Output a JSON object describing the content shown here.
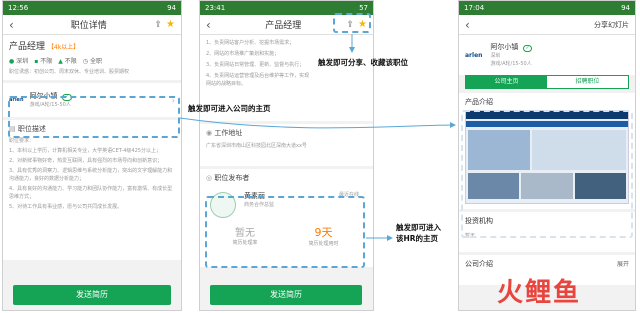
{
  "phone1": {
    "status": {
      "time": "12:56",
      "battery": "94"
    },
    "nav_title": "职位详情",
    "job_title": "产品经理",
    "salary": "【4k以上】",
    "tags": [
      "深圳",
      "不限",
      "不限",
      "全职"
    ],
    "benefits": "职位诱惑：初创公司、周末双休、专业培训、股票期权",
    "company_name": "阿尔小镇",
    "company_sub": "游戏/A轮/15-50人",
    "desc_header": "职位描述",
    "desc_lines": [
      "职位要求：",
      "1、本科以上学历，计算机相关专业，大学英语CET-4级425分以上；",
      "2、对新鲜事物好奇，热爱互联网，具有强烈的市场导向和创新意识；",
      "3、具有优秀的洞察力、逻辑思维与系统分析能力，突出的文字理解能力和沟通能力，良好的数据分析能力；",
      "4、具有良好的沟通能力、学习能力和团队协作能力，富有激情、有成长型思维方式；",
      "5、对待工作具有事业感，愿与公司共同成长发展。"
    ],
    "send_button": "发送简历"
  },
  "phone2": {
    "status": {
      "time": "23:41",
      "battery": "57"
    },
    "nav_title": "产品经理",
    "duties": [
      "1、负责网站客户分析、挖掘市场需求；",
      "2、网站的市场推广策划和实施；",
      "3、负责网站日常管理、更新、监督与执行；",
      "4、负责网站运营管理及后台维护等工作，实现网站的战略目标。"
    ],
    "address_header": "工作地址",
    "address": "广东省深圳市南山区科技园北区深南大道xx号",
    "publisher_header": "职位发布者",
    "publisher_name": "黄素丽",
    "publisher_role": "商务合作总监",
    "publisher_online": "最近在线",
    "stat1_value": "暂无",
    "stat1_label": "简历处理率",
    "stat2_value": "9天",
    "stat2_label": "简历处理用时",
    "send_button": "发送简历"
  },
  "phone3": {
    "status": {
      "time": "17:04",
      "battery": "94"
    },
    "share_label": "分享幻灯片",
    "company_name": "阿尔小镇",
    "company_city": "深圳",
    "company_sub": "游戏/A轮/15-50人",
    "tab1": "公司主页",
    "tab2": "招聘职位",
    "intro_header": "产品介绍",
    "investor_header": "投资机构",
    "investor_value": "暂无",
    "company_intro_header": "公司介绍",
    "expand": "展开"
  },
  "annotations": {
    "share_note": "触发即可分享、收藏该职位",
    "company_note": "触发即可进入公司的主页",
    "hr_note": "触发即可进入该HR的主页"
  },
  "watermark": "火鲤鱼",
  "colors": {
    "green": "#15a356",
    "dash": "#5aa7d6",
    "orange": "#ff7a00"
  }
}
